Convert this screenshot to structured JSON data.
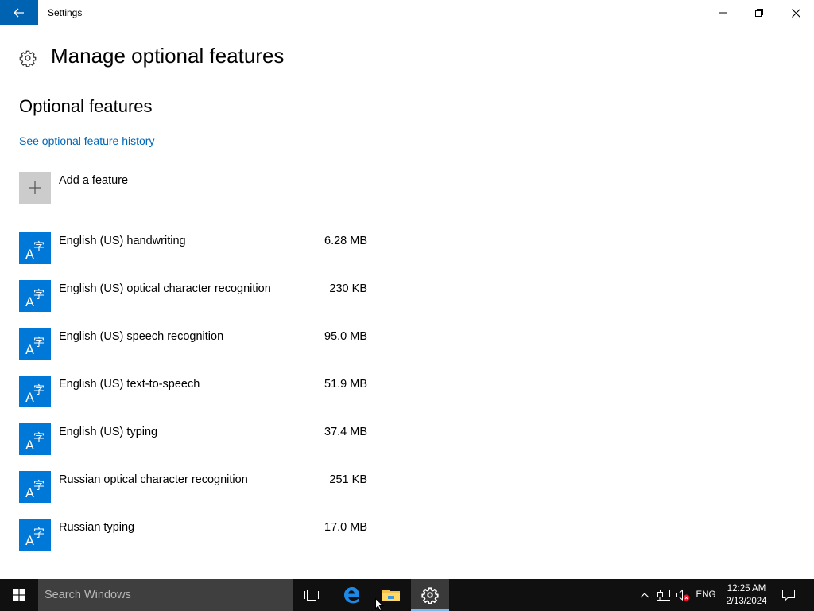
{
  "window": {
    "title": "Settings",
    "back_icon": "back-arrow-icon",
    "controls": [
      "minimize-icon",
      "maximize-icon",
      "close-icon"
    ]
  },
  "page": {
    "title": "Manage optional features",
    "icon": "gear-icon"
  },
  "section": {
    "title": "Optional features",
    "history_link": "See optional feature history"
  },
  "add_feature": {
    "label": "Add a feature",
    "icon": "plus-icon"
  },
  "features": [
    {
      "name": "English (US) handwriting",
      "size": "6.28 MB",
      "icon": "language-icon"
    },
    {
      "name": "English (US) optical character recognition",
      "size": "230 KB",
      "icon": "language-icon"
    },
    {
      "name": "English (US) speech recognition",
      "size": "95.0 MB",
      "icon": "language-icon"
    },
    {
      "name": "English (US) text-to-speech",
      "size": "51.9 MB",
      "icon": "language-icon"
    },
    {
      "name": "English (US) typing",
      "size": "37.4 MB",
      "icon": "language-icon"
    },
    {
      "name": "Russian optical character recognition",
      "size": "251 KB",
      "icon": "language-icon"
    },
    {
      "name": "Russian typing",
      "size": "17.0 MB",
      "icon": "language-icon"
    }
  ],
  "taskbar": {
    "search_placeholder": "Search Windows",
    "language": "ENG",
    "time": "12:25 AM",
    "date": "2/13/2024"
  },
  "colors": {
    "accent": "#0078d7",
    "link": "#0067b8",
    "taskbar": "#101010"
  }
}
